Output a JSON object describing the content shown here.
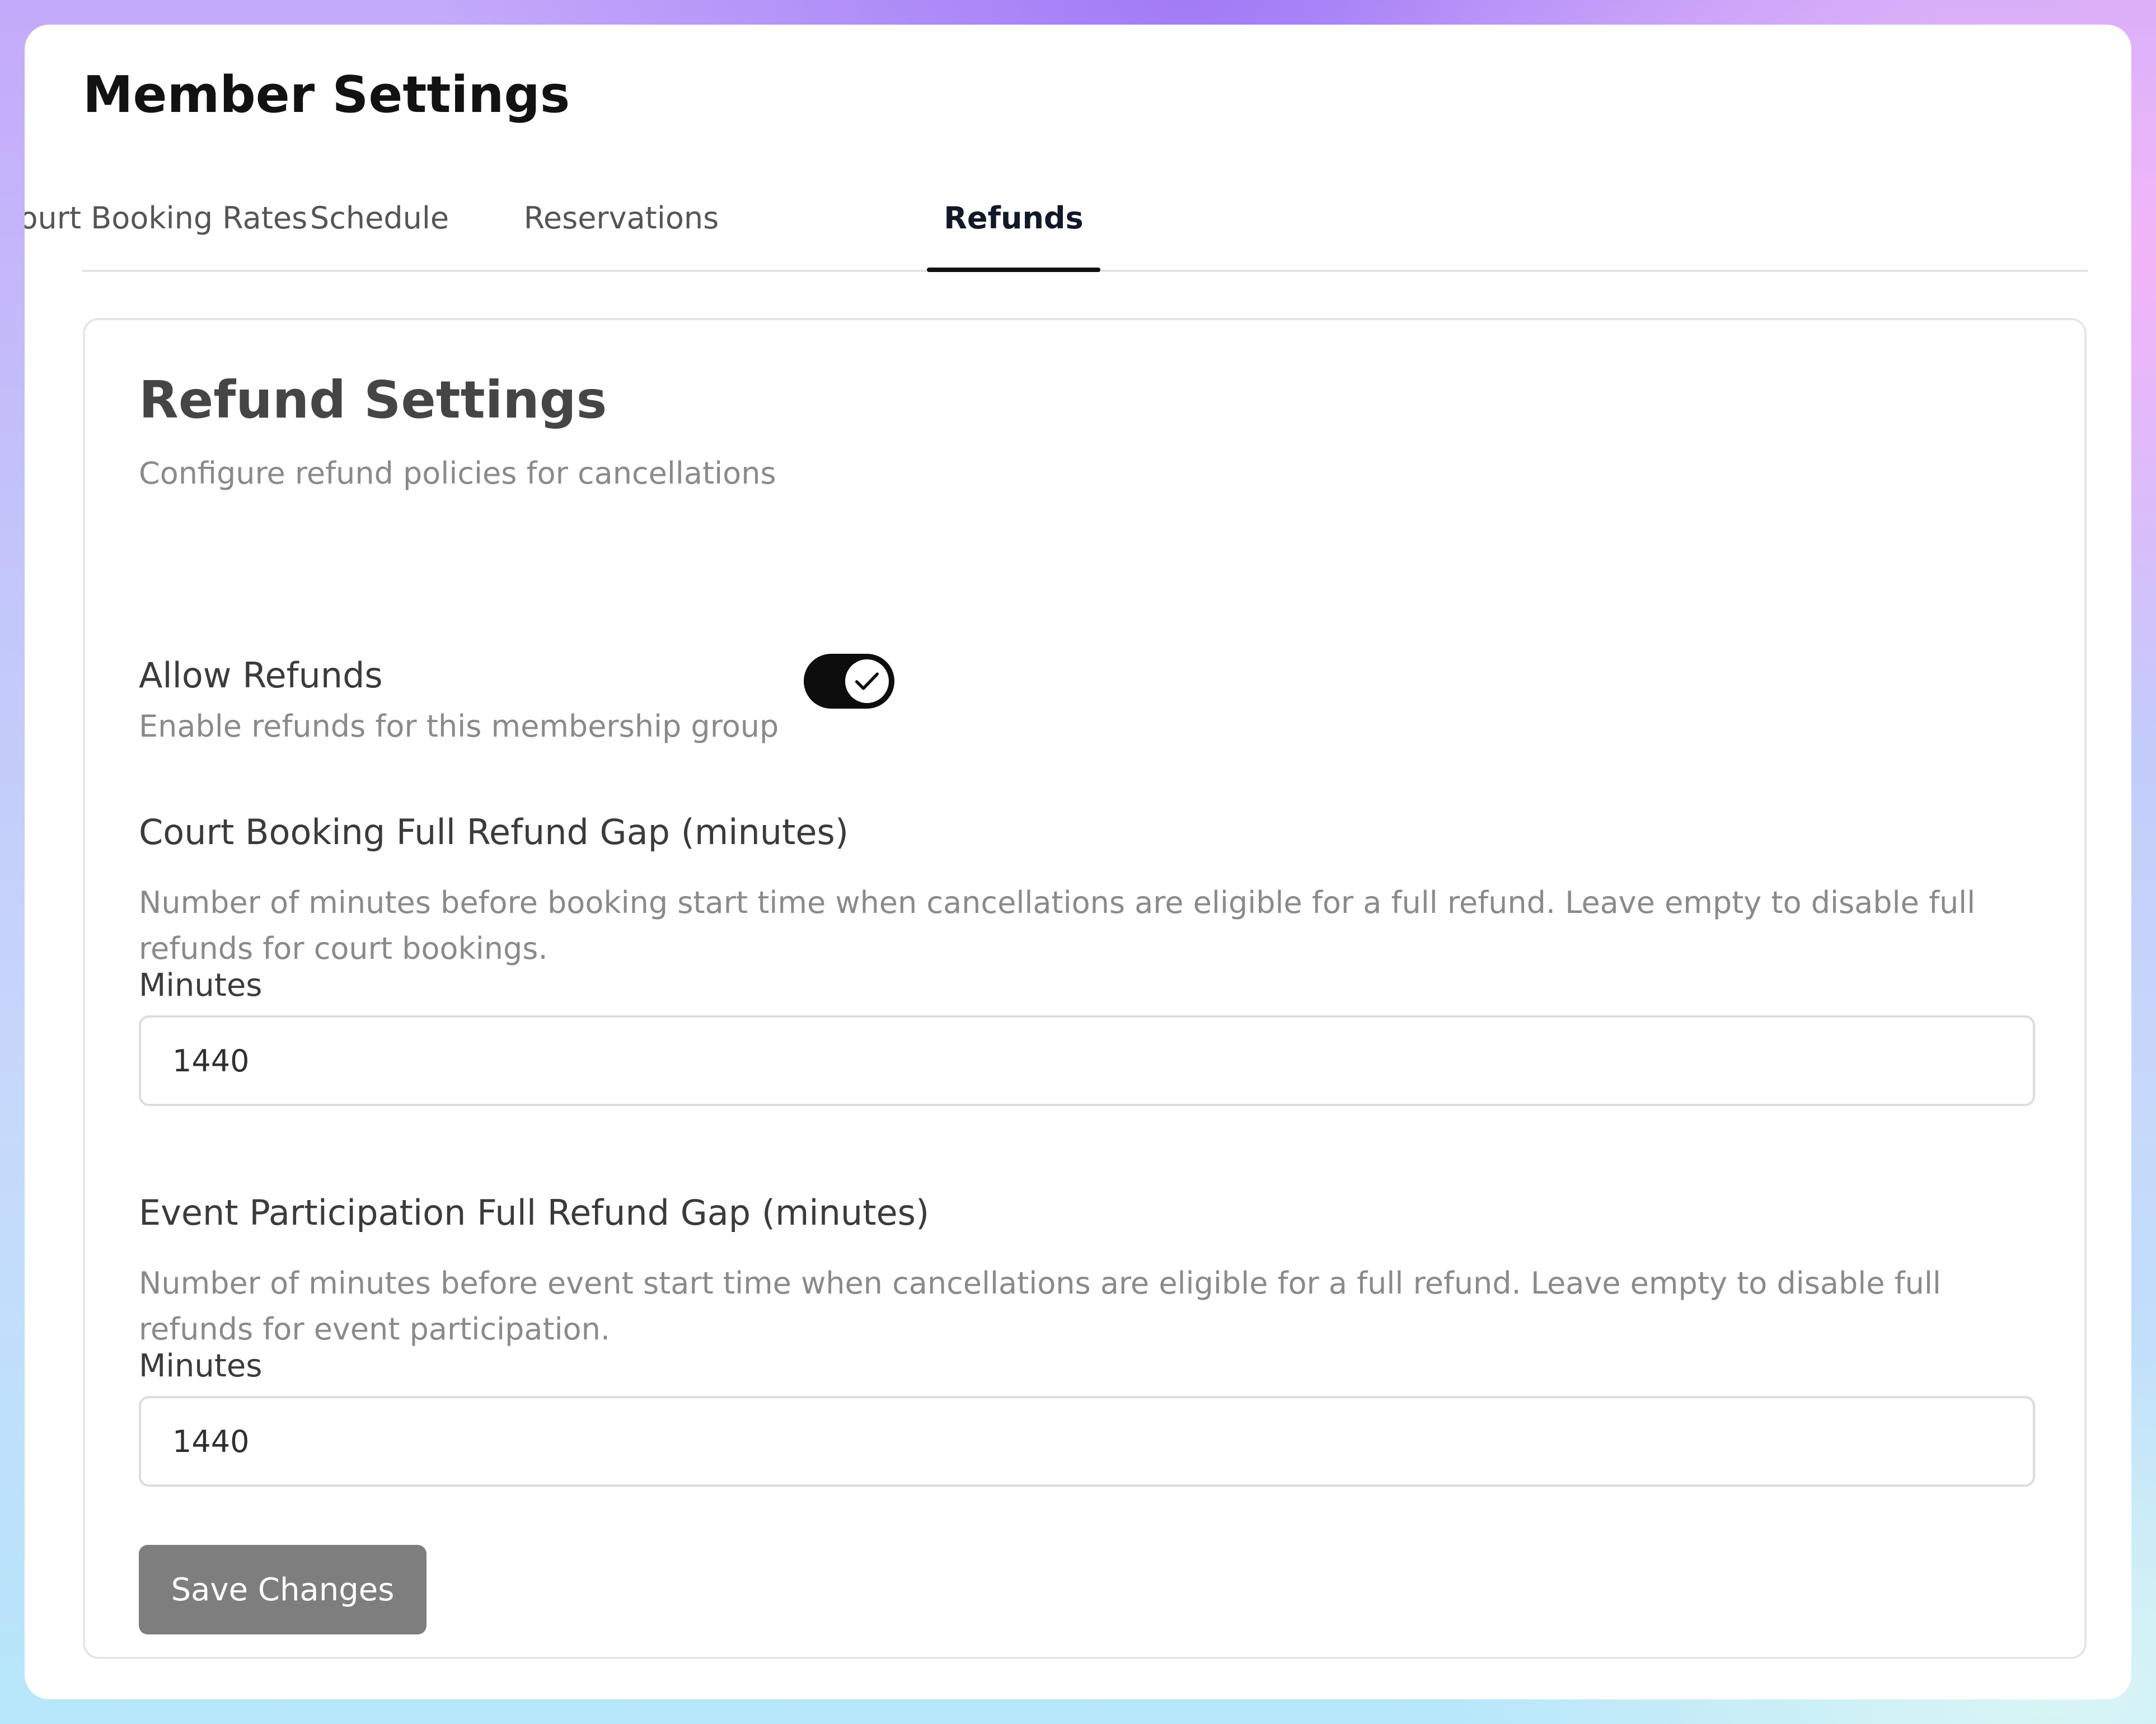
{
  "page": {
    "title": "Member Settings"
  },
  "tabs": [
    {
      "label": "Court Booking Rates",
      "active": false
    },
    {
      "label": "Schedule",
      "active": false
    },
    {
      "label": "Reservations",
      "active": false
    },
    {
      "label": "Refunds",
      "active": true
    }
  ],
  "card": {
    "title": "Refund Settings",
    "subtitle": "Configure refund policies for cancellations"
  },
  "allow_refunds": {
    "label": "Allow Refunds",
    "description": "Enable refunds for this membership group",
    "enabled": true
  },
  "court_booking_gap": {
    "title": "Court Booking Full Refund Gap (minutes)",
    "description": "Number of minutes before booking start time when cancellations are eligible for a full refund. Leave empty to disable full refunds for court bookings.",
    "field_label": "Minutes",
    "value": "1440"
  },
  "event_participation_gap": {
    "title": "Event Participation Full Refund Gap (minutes)",
    "description": "Number of minutes before event start time when cancellations are eligible for a full refund. Leave empty to disable full refunds for event participation.",
    "field_label": "Minutes",
    "value": "1440"
  },
  "actions": {
    "save_label": "Save Changes"
  },
  "colors": {
    "toggle_on": "#0d0d0d",
    "save_button": "#7e7e7e",
    "active_tab_indicator": "#111111"
  },
  "icons": {
    "toggle_knob": "check-icon"
  }
}
